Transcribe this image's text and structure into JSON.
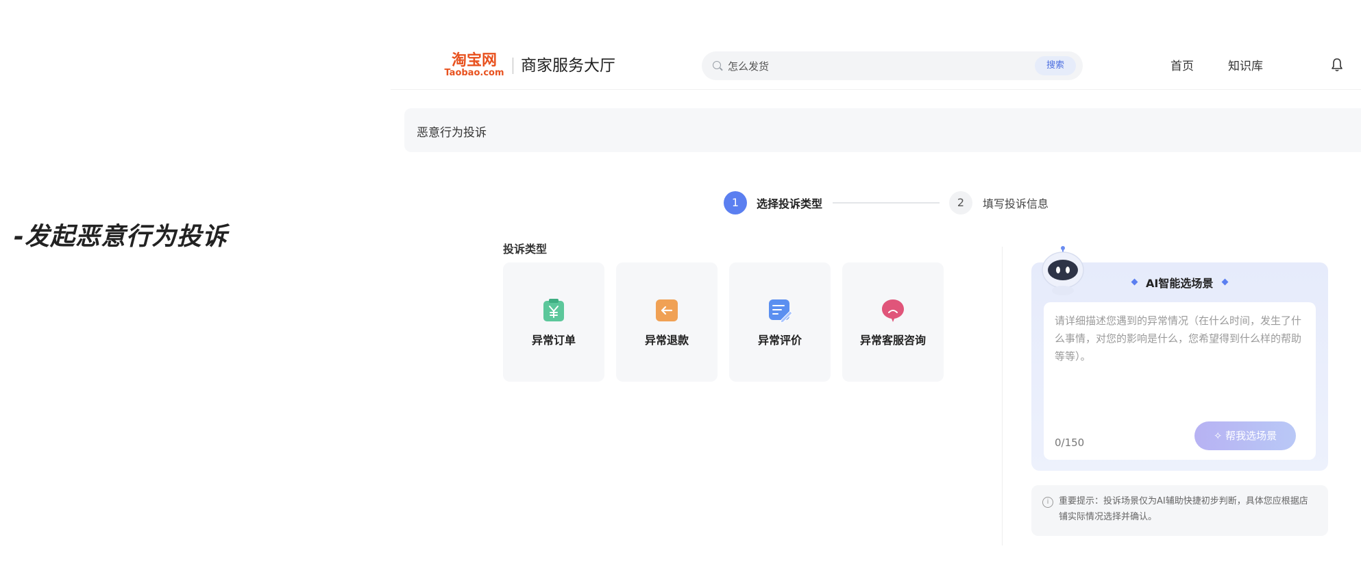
{
  "caption": "-发起恶意行为投诉",
  "header": {
    "logo_cn": "淘宝网",
    "logo_en": "Taobao.com",
    "site_title": "商家服务大厅",
    "search_placeholder": "怎么发货",
    "search_button": "搜索",
    "nav": [
      "首页",
      "知识库"
    ],
    "bell_icon": "bell-icon"
  },
  "breadcrumb": "恶意行为投诉",
  "steps": [
    {
      "number": "1",
      "label": "选择投诉类型",
      "active": true
    },
    {
      "number": "2",
      "label": "填写投诉信息",
      "active": false
    }
  ],
  "complaint_types": {
    "title": "投诉类型",
    "items": [
      {
        "label": "异常订单",
        "icon": "order-yen-icon",
        "color": "#5cc79b"
      },
      {
        "label": "异常退款",
        "icon": "refund-arrow-icon",
        "color": "#f0a155"
      },
      {
        "label": "异常评价",
        "icon": "review-edit-icon",
        "color": "#5b8ff0"
      },
      {
        "label": "异常客服咨询",
        "icon": "sad-chat-icon",
        "color": "#e0557a"
      }
    ]
  },
  "ai_panel": {
    "title": "AI智能选场景",
    "placeholder": "请详细描述您遇到的异常情况（在什么时间，发生了什么事情，对您的影响是什么，您希望得到什么样的帮助等等）。",
    "counter": "0/150",
    "help_button": "帮我选场景",
    "help_icon": "sparkle-icon",
    "avatar_icon": "robot-icon"
  },
  "tip": {
    "icon": "info-icon",
    "text": "重要提示：投诉场景仅为AI辅助快捷初步判断，具体您应根据店铺实际情况选择并确认。"
  },
  "colors": {
    "accent": "#5b7ff0",
    "brand": "#e8521f"
  }
}
